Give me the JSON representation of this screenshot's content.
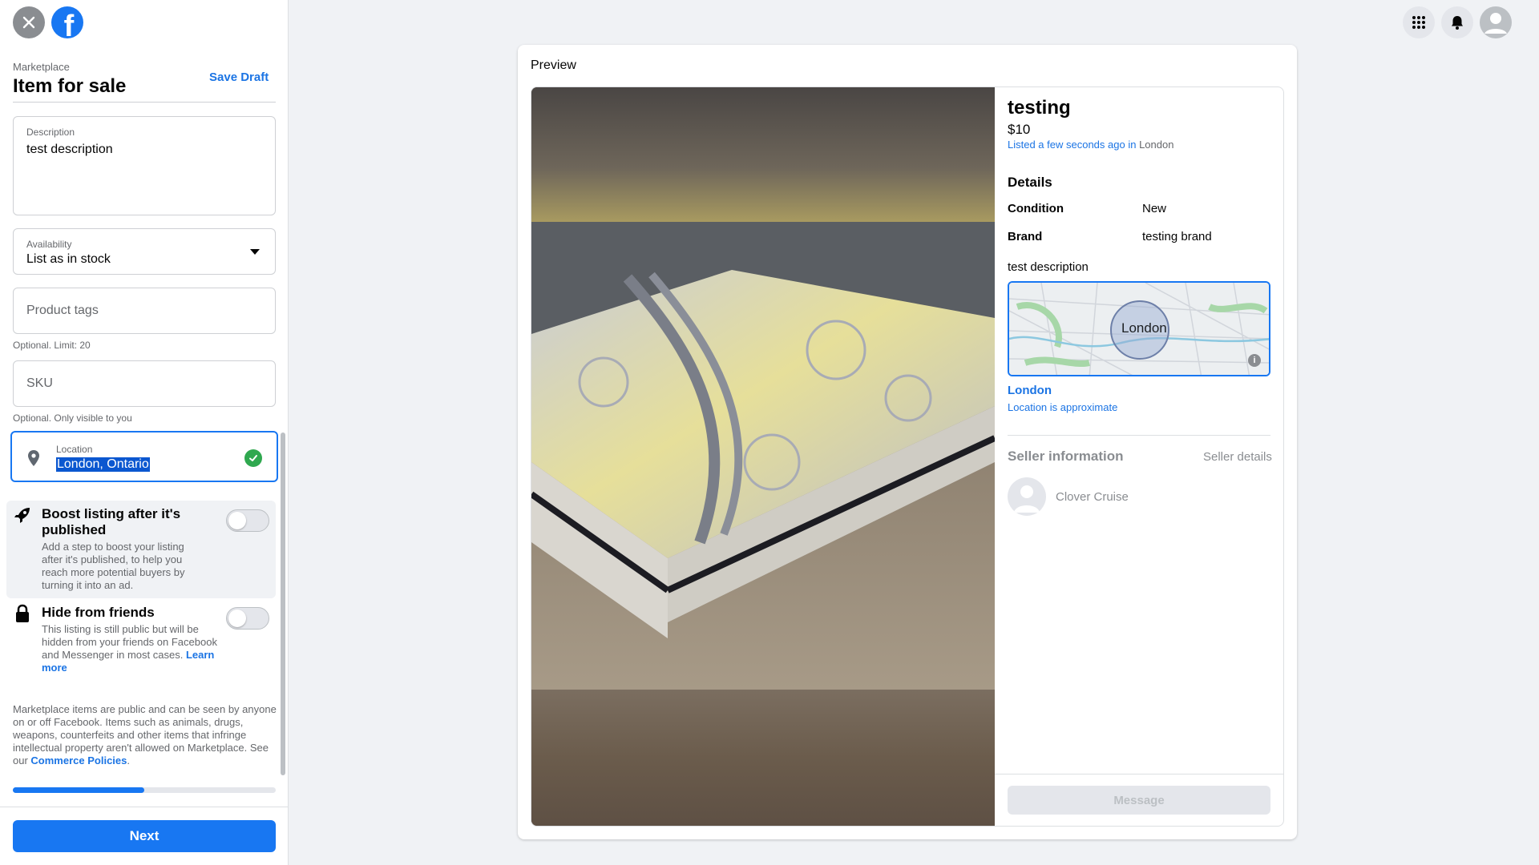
{
  "app": {
    "close_icon": "close-icon",
    "logo_icon": "facebook-logo-icon",
    "logo_letter": "f",
    "brand_color": "#1877f2"
  },
  "header": {
    "breadcrumb": "Marketplace",
    "title": "Item for sale",
    "save_draft": "Save Draft"
  },
  "form": {
    "description": {
      "label": "Description",
      "value": "test description"
    },
    "availability": {
      "label": "Availability",
      "value": "List as in stock"
    },
    "product_tags": {
      "placeholder": "Product tags",
      "helper": "Optional. Limit: 20"
    },
    "sku": {
      "placeholder": "SKU",
      "helper": "Optional. Only visible to you"
    },
    "location": {
      "label": "Location",
      "value": "London, Ontario",
      "status_icon": "check-circle-icon"
    }
  },
  "options": {
    "boost": {
      "icon": "rocket-icon",
      "title": "Boost listing after it's published",
      "description": "Add a step to boost your listing after it's published, to help you reach more potential buyers by turning it into an ad.",
      "enabled": false
    },
    "hide": {
      "icon": "lock-icon",
      "title": "Hide from friends",
      "description": "This listing is still public but will be hidden from your friends on Facebook and Messenger in most cases.",
      "link": "Learn more",
      "enabled": false
    }
  },
  "policy": {
    "text": "Marketplace items are public and can be seen by anyone on or off Facebook. Items such as animals, drugs, weapons, counterfeits and other items that infringe intellectual property aren't allowed on Marketplace. See our",
    "link": "Commerce Policies",
    "end": "."
  },
  "progress": {
    "fraction": 0.5
  },
  "footer": {
    "next": "Next"
  },
  "topbar": {
    "icons": [
      "menu-grid-icon",
      "notifications-bell-icon",
      "account-avatar-icon"
    ]
  },
  "preview": {
    "label": "Preview",
    "title": "testing",
    "price": "$10",
    "listed": "Listed a few seconds ago in",
    "listed_city": "London",
    "details_heading": "Details",
    "details": [
      {
        "label": "Condition",
        "value": "New"
      },
      {
        "label": "Brand",
        "value": "testing brand"
      }
    ],
    "description": "test description",
    "map_city": "London",
    "location_name": "London",
    "location_note": "Location is approximate",
    "seller_heading": "Seller information",
    "seller_link": "Seller details",
    "seller_name": "Clover Cruise",
    "message_button": "Message"
  }
}
